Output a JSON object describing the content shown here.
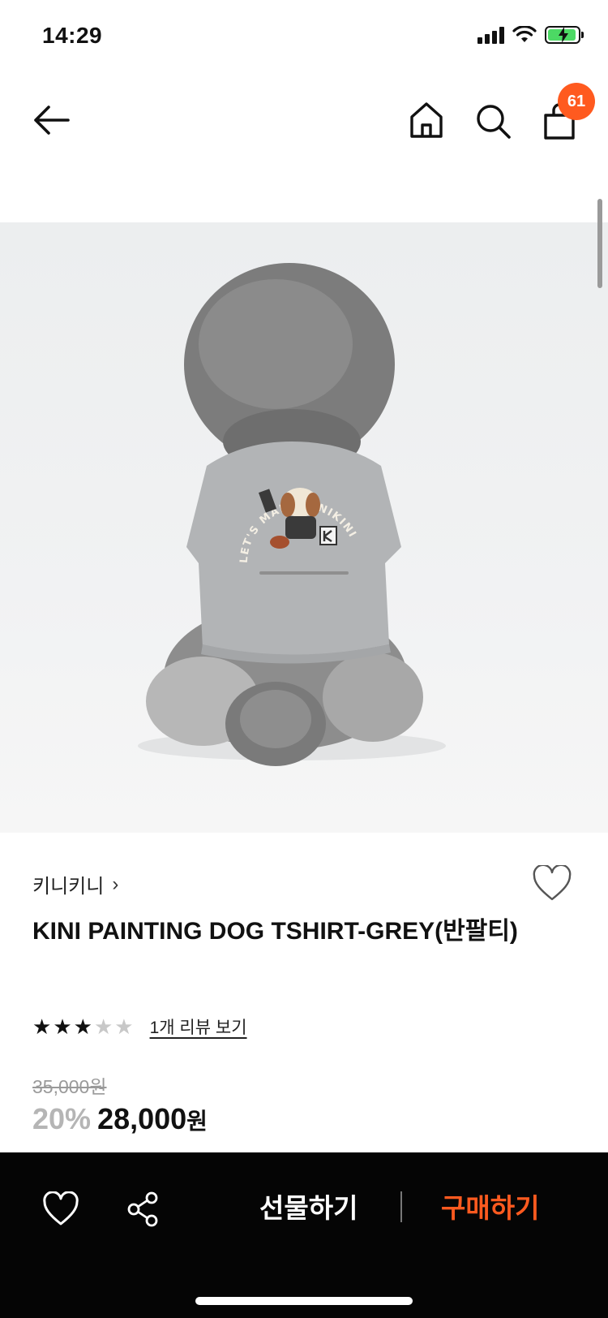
{
  "status_bar": {
    "time": "14:29"
  },
  "nav": {
    "back_icon": "arrow-left-icon",
    "home_icon": "home-icon",
    "search_icon": "search-icon",
    "bag_icon": "shopping-bag-icon",
    "cart_count": "61",
    "badge_color": "#ff5a1f"
  },
  "product": {
    "brand": "키니키니",
    "brand_chevron": "›",
    "title": "KINI PAINTING DOG TSHIRT-GREY(반팔티)",
    "rating": 3,
    "rating_max": 5,
    "review_link": "1개 리뷰 보기",
    "original_price": "35,000원",
    "discount": "20%",
    "sale_price": "28,000",
    "currency": "원",
    "image_alt": "Grey poodle wearing grey t-shirt, back view",
    "shirt_print": "LET'S MAKE KINIKINI",
    "carousel_active_index": 1,
    "carousel_count": 4
  },
  "bottom_bar": {
    "heart_icon": "heart-outline-icon",
    "share_icon": "share-icon",
    "gift_label": "선물하기",
    "buy_label": "구매하기",
    "accent_color": "#ff5a1f"
  }
}
